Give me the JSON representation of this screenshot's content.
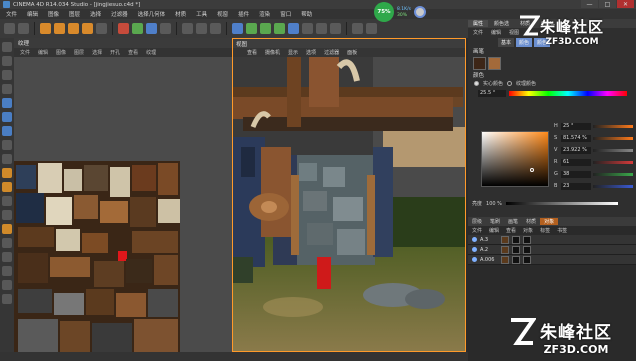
{
  "window": {
    "title": "CINEMA 4D R14.034 Studio - [jingjiesuo.c4d *]",
    "controls": [
      "—",
      "□",
      "✕"
    ]
  },
  "menubar": [
    "文件",
    "编辑",
    "图像",
    "图层",
    "选择",
    "过滤器",
    "选择几何体",
    "材质",
    "工具",
    "视窗",
    "插件",
    "渲染",
    "窗口",
    "帮助"
  ],
  "perf_widget": {
    "percent": "75%",
    "upload": "8.1K/s",
    "download": "30%"
  },
  "texture_panel": {
    "title": "纹理",
    "menu": [
      "文件",
      "编辑",
      "图像",
      "图层",
      "选择",
      "开孔",
      "查看",
      "纹理"
    ]
  },
  "viewport": {
    "title": "视图",
    "menu": [
      "查看",
      "摄像机",
      "显示",
      "选项",
      "过滤器",
      "面板"
    ]
  },
  "right_panel": {
    "tabs": [
      "属性",
      "颜色选",
      "材质",
      "ODAL"
    ],
    "menu": [
      "文件",
      "编辑",
      "视图"
    ],
    "modes": [
      "基本",
      "颜色",
      "颜色"
    ],
    "section_material": "画笔",
    "section_color": "颜色",
    "radio_options": [
      "实心颜色",
      "纹理颜色"
    ],
    "hue_value": "25.5 °",
    "sliders": [
      {
        "label": "H",
        "value": "25 °",
        "color": "#ff7a1a"
      },
      {
        "label": "S",
        "value": "81.574 %",
        "color": "#ff7a1a"
      },
      {
        "label": "V",
        "value": "23.922 %",
        "color": "#888888"
      },
      {
        "label": "R",
        "value": "61",
        "color": "#d43a3a"
      },
      {
        "label": "G",
        "value": "38",
        "color": "#3aa84a"
      },
      {
        "label": "B",
        "value": "23",
        "color": "#3a5ad4"
      }
    ],
    "brightness_label": "亮度",
    "brightness_value": "100 %"
  },
  "layer_panel": {
    "tabs": [
      "层级",
      "笔刷",
      "画笔",
      "材质",
      "对象"
    ],
    "menu": [
      "文件",
      "编辑",
      "查看",
      "对象",
      "标签",
      "书签"
    ],
    "rows": [
      {
        "name": "A.3"
      },
      {
        "name": "A.2"
      },
      {
        "name": "A.006"
      }
    ]
  },
  "watermark": {
    "text_zh": "朱峰社区",
    "text_en": "ZF3D.COM"
  }
}
